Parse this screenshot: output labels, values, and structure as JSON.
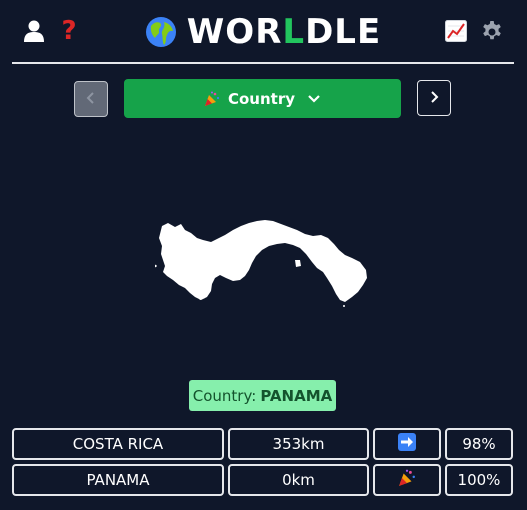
{
  "app": {
    "title_prefix": "WOR",
    "title_highlight": "L",
    "title_suffix": "DLE",
    "accent_color": "#22c55e",
    "background_color": "#0f172a"
  },
  "header": {
    "left_icons": [
      "user-icon",
      "help-icon"
    ],
    "help_glyph": "?",
    "right_icons": [
      "stats-icon",
      "gear-icon"
    ]
  },
  "nav": {
    "mode_label": "Country",
    "mode_icon": "party-popper-icon",
    "prev_icon": "chevron-left-icon",
    "next_icon": "chevron-right-icon",
    "dropdown_icon": "chevron-down-icon"
  },
  "answer": {
    "label": "Country:",
    "value": "PANAMA"
  },
  "guesses": [
    {
      "country": "COSTA RICA",
      "distance": "353km",
      "direction_icon": "arrow-right-icon",
      "proximity": "98%"
    },
    {
      "country": "PANAMA",
      "distance": "0km",
      "direction_icon": "party-popper-icon",
      "proximity": "100%"
    }
  ]
}
